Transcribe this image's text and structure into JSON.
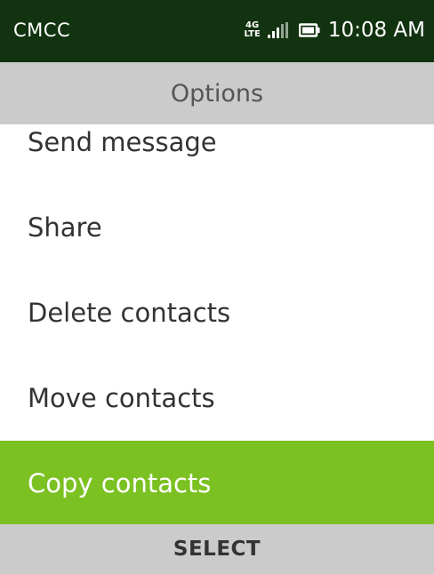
{
  "status_bar": {
    "carrier": "CMCC",
    "network_top": "4G",
    "network_bottom": "LTE",
    "signal_icon": "signal-bars-icon",
    "battery_icon": "battery-icon",
    "time": "10:08 AM"
  },
  "header": {
    "title": "Options"
  },
  "menu": {
    "items": [
      {
        "label": "Send message",
        "focused": false
      },
      {
        "label": "Share",
        "focused": false
      },
      {
        "label": "Delete contacts",
        "focused": false
      },
      {
        "label": "Move contacts",
        "focused": false
      },
      {
        "label": "Copy contacts",
        "focused": true
      }
    ]
  },
  "softkeys": {
    "center": "SELECT"
  },
  "colors": {
    "status_bar_bg": "#11330f",
    "header_bg": "#cbcbcb",
    "focus_bg": "#7bc122",
    "text": "#333333"
  }
}
